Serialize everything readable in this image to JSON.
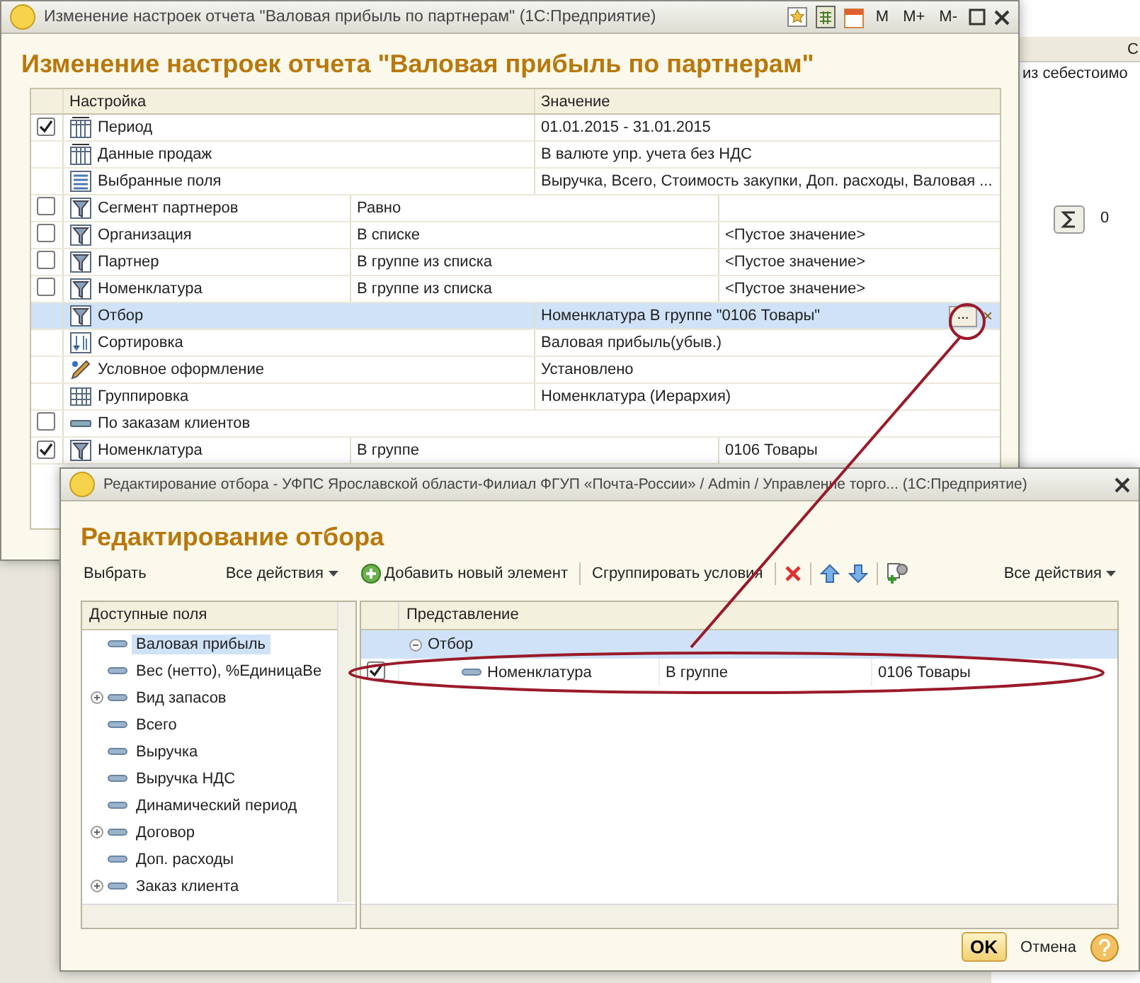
{
  "background_window": {
    "column_header": "С",
    "text": "из себестоимо",
    "sum_value": "0"
  },
  "settings_window": {
    "title": "Изменение настроек отчета \"Валовая прибыль по партнерам\"  (1С:Предприятие)",
    "toolbar": [
      "M",
      "M+",
      "M-"
    ],
    "heading": "Изменение настроек отчета \"Валовая прибыль по партнерам\"",
    "columns": [
      "Настройка",
      "Значение"
    ],
    "rows": [
      {
        "kind": "parameter",
        "checked": true,
        "name": "Период",
        "value": "01.01.2015 - 31.01.2015",
        "selected": false
      },
      {
        "kind": "parameter",
        "name": "Данные продаж",
        "value": "В валюте упр. учета без НДС",
        "selected": false
      },
      {
        "kind": "fields",
        "name": "Выбранные поля",
        "value": "Выручка, Всего, Стоимость закупки, Доп. расходы, Валовая ...",
        "selected": false
      },
      {
        "kind": "filter",
        "checked": false,
        "name": "Сегмент партнеров",
        "condition": "Равно",
        "selected": false
      },
      {
        "kind": "filter",
        "checked": false,
        "name": "Организация",
        "condition": "В списке",
        "value": "<Пустое значение>",
        "selected": false
      },
      {
        "kind": "filter",
        "checked": false,
        "name": "Партнер",
        "condition": "В группе из списка",
        "value": "<Пустое значение>",
        "selected": false
      },
      {
        "kind": "filter",
        "checked": false,
        "name": "Номенклатура",
        "condition": "В группе из списка",
        "value": "<Пустое значение>",
        "selected": false
      },
      {
        "kind": "selection",
        "name": "Отбор",
        "value": "Номенклатура В группе \"0106 Товары\"",
        "selected": true,
        "button": "...",
        "clear": "×"
      },
      {
        "kind": "order",
        "name": "Сортировка",
        "value": "Валовая прибыль(убыв.)",
        "selected": false
      },
      {
        "kind": "appearance",
        "name": "Условное оформление",
        "value": "Установлено",
        "selected": false
      },
      {
        "kind": "grouping",
        "name": "Группировка",
        "value": "Номенклатура (Иерархия)",
        "selected": false
      },
      {
        "kind": "flag",
        "checked": false,
        "name": "По заказам клиентов",
        "selected": false
      },
      {
        "kind": "filter",
        "checked": true,
        "name": "Номенклатура",
        "condition": "В группе",
        "value": "0106 Товары",
        "selected": false
      }
    ]
  },
  "filter_dialog": {
    "title": "Редактирование отбора - УФПС Ярославской области-Филиал ФГУП «Почта-России» / Admin / Управление торго...  (1С:Предприятие)",
    "heading": "Редактирование отбора",
    "left_toolbar": {
      "select": "Выбрать",
      "actions": "Все действия"
    },
    "right_toolbar": {
      "add": "Добавить новый элемент",
      "group": "Сгруппировать условия",
      "actions": "Все действия"
    },
    "fields": {
      "header": "Доступные поля",
      "items": [
        {
          "label": "Валовая прибыль",
          "expandable": false,
          "selected": true
        },
        {
          "label": "Вес (нетто), %ЕдиницаВе",
          "expandable": false,
          "selected": false
        },
        {
          "label": "Вид запасов",
          "expandable": true,
          "selected": false
        },
        {
          "label": "Всего",
          "expandable": false,
          "selected": false
        },
        {
          "label": "Выручка",
          "expandable": false,
          "selected": false
        },
        {
          "label": "Выручка НДС",
          "expandable": false,
          "selected": false
        },
        {
          "label": "Динамический период",
          "expandable": false,
          "selected": false
        },
        {
          "label": "Договор",
          "expandable": true,
          "selected": false
        },
        {
          "label": "Доп. расходы",
          "expandable": false,
          "selected": false
        },
        {
          "label": "Заказ клиента",
          "expandable": true,
          "selected": false
        }
      ]
    },
    "conditions": {
      "header": "Представление",
      "group": {
        "label": "Отбор",
        "expanded": true
      },
      "items": [
        {
          "checked": true,
          "field": "Номенклатура",
          "condition": "В группе",
          "value": "0106 Товары"
        }
      ]
    },
    "buttons": {
      "ok": "OK",
      "cancel": "Отмена"
    }
  }
}
